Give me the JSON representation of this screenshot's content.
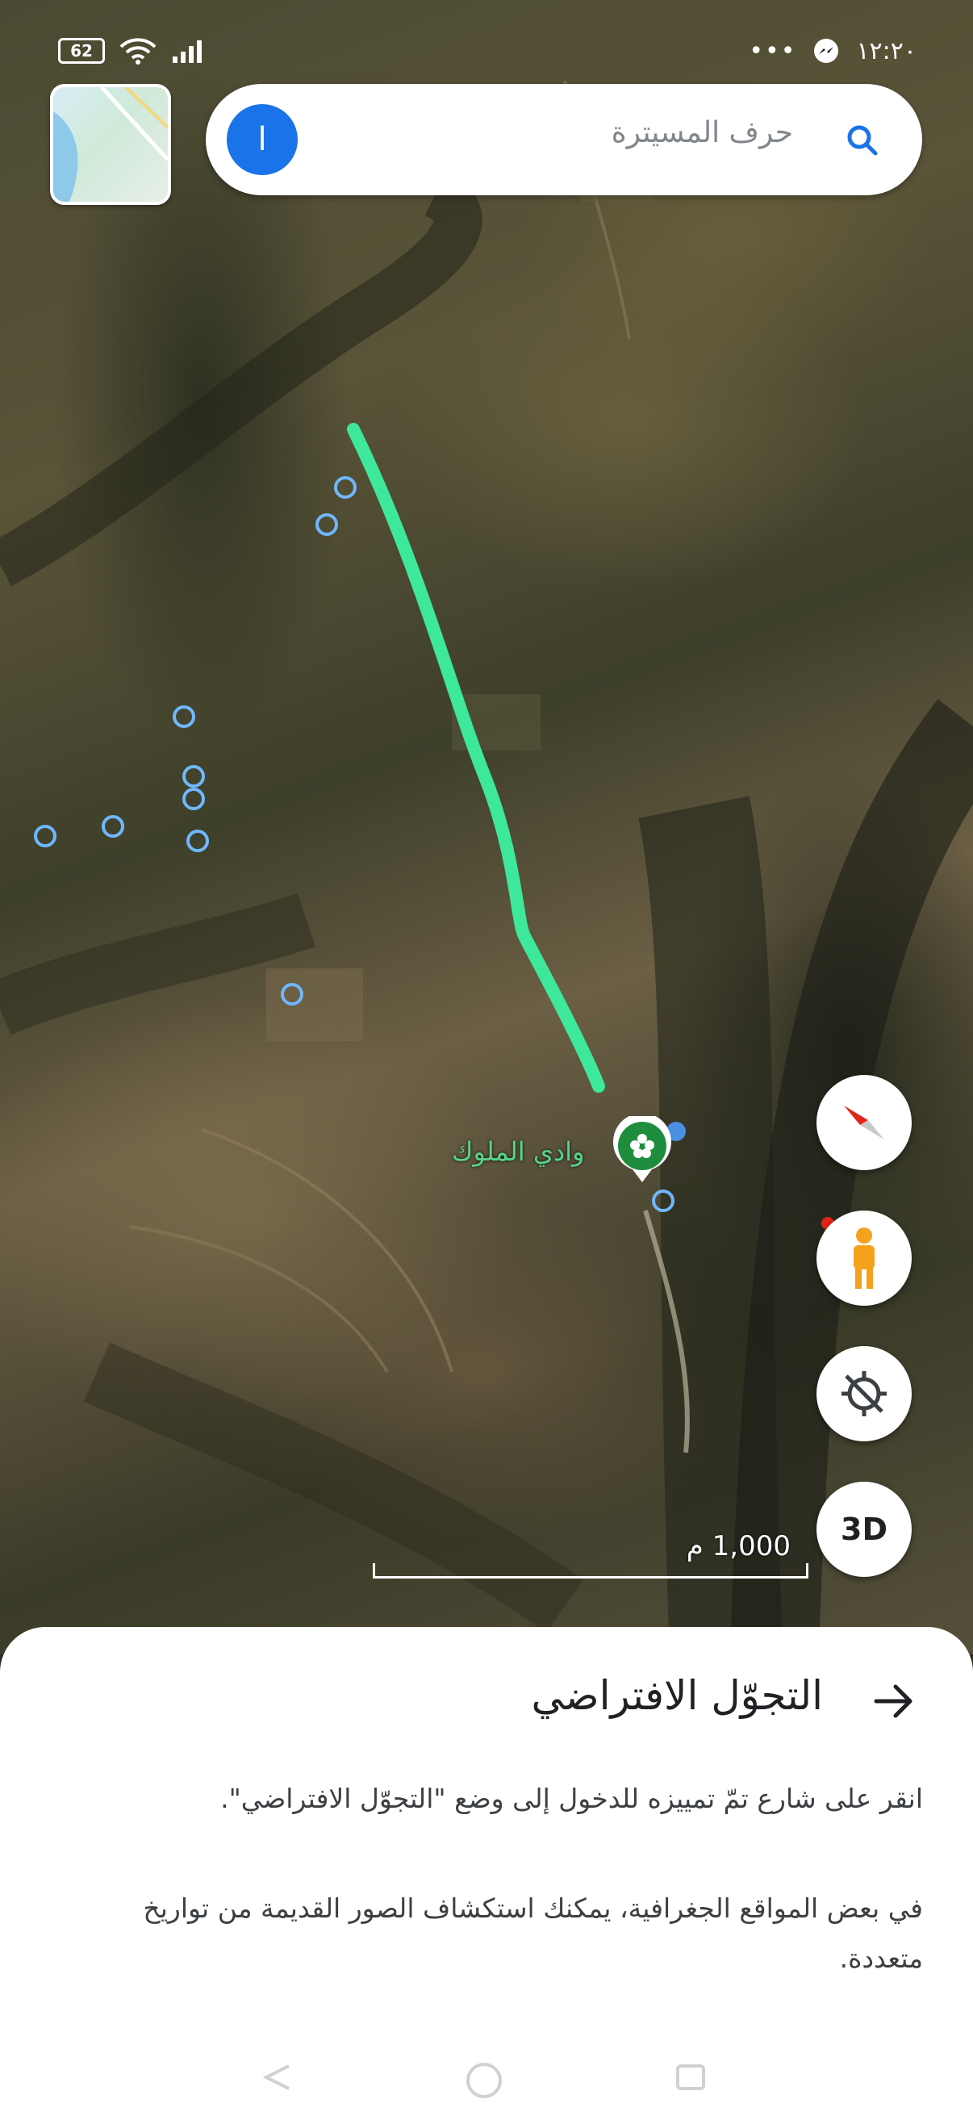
{
  "status_bar": {
    "battery": "62",
    "time": "١٢:٢٠"
  },
  "search": {
    "placeholder": "حرف المسيترة",
    "avatar_initial": "ا"
  },
  "map": {
    "place_label": "وادي الملوك",
    "scale_label": "1,000 م",
    "route_color": "#3ee89a"
  },
  "controls": {
    "three_d_label": "3D"
  },
  "sheet": {
    "title": "التجوّل الافتراضي",
    "paragraph1": "انقر على شارع تمّ تمييزه للدخول إلى وضع \"التجوّل الافتراضي\".",
    "paragraph2": "في بعض المواقع الجغرافية، يمكنك استكشاف الصور القديمة من تواريخ متعددة."
  },
  "colors": {
    "accent": "#1a73e8",
    "route": "#3ee89a",
    "poi": "#1e8e3e"
  }
}
